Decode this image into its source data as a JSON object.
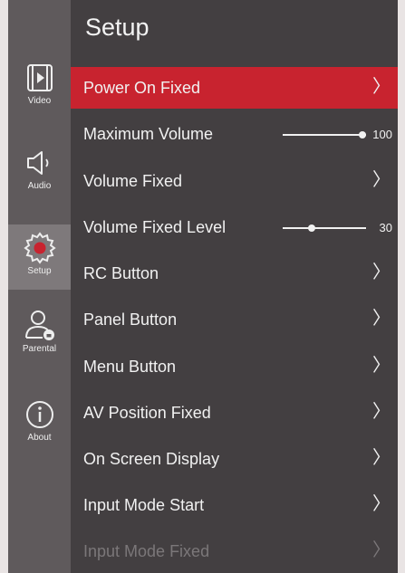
{
  "title": "Setup",
  "sidebar": {
    "items": [
      {
        "label": "Video",
        "icon": "film-play-icon"
      },
      {
        "label": "Audio",
        "icon": "speaker-icon"
      },
      {
        "label": "Setup",
        "icon": "gear-icon",
        "active": true
      },
      {
        "label": "Parental",
        "icon": "user-lock-icon"
      },
      {
        "label": "About",
        "icon": "info-icon"
      }
    ]
  },
  "menu": {
    "items": [
      {
        "label": "Power On Fixed",
        "type": "submenu",
        "selected": true
      },
      {
        "label": "Maximum Volume",
        "type": "slider",
        "value": "100",
        "level": 1.0
      },
      {
        "label": "Volume Fixed",
        "type": "submenu"
      },
      {
        "label": "Volume Fixed Level",
        "type": "slider",
        "value": "30",
        "level": 0.3
      },
      {
        "label": "RC Button",
        "type": "submenu"
      },
      {
        "label": "Panel Button",
        "type": "submenu"
      },
      {
        "label": "Menu Button",
        "type": "submenu"
      },
      {
        "label": "AV Position Fixed",
        "type": "submenu"
      },
      {
        "label": "On Screen Display",
        "type": "submenu"
      },
      {
        "label": "Input Mode Start",
        "type": "submenu"
      },
      {
        "label": "Input Mode Fixed",
        "type": "submenu",
        "disabled": true
      }
    ],
    "chevron": "〉"
  },
  "colors": {
    "accent": "#c8232f",
    "sidebar": "#5f5a5c",
    "panel": "#433f41"
  }
}
